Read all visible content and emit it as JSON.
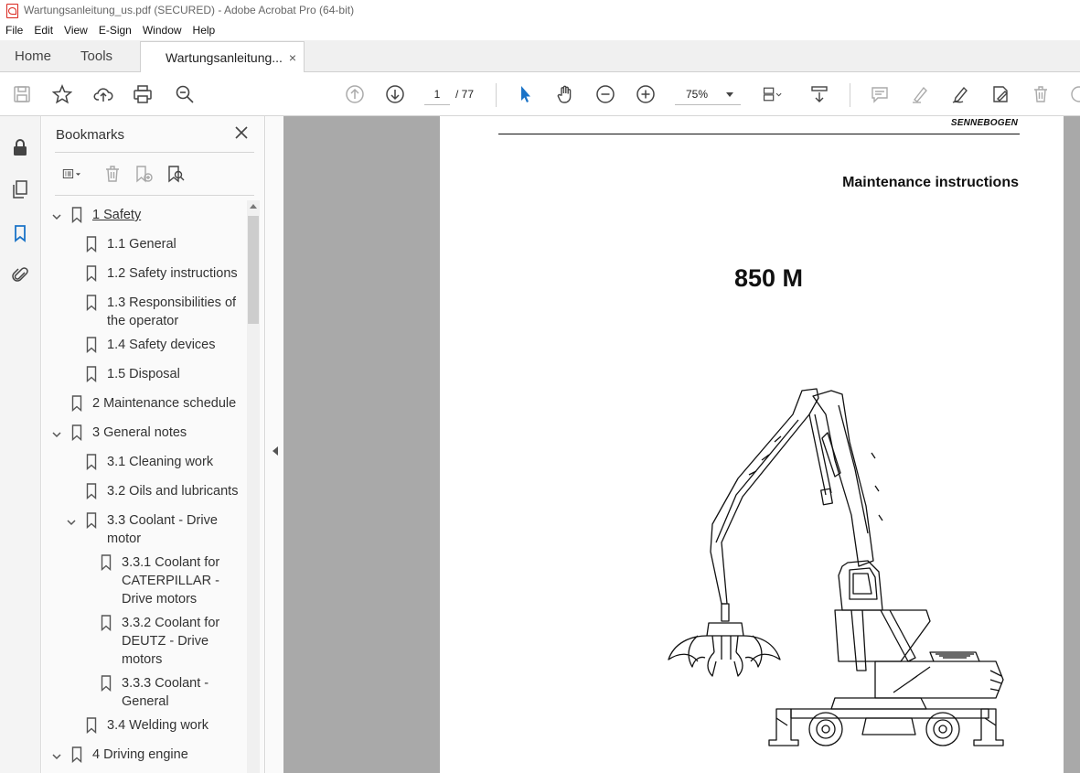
{
  "window": {
    "title": "Wartungsanleitung_us.pdf (SECURED) - Adobe Acrobat Pro (64-bit)"
  },
  "menu": [
    "File",
    "Edit",
    "View",
    "E-Sign",
    "Window",
    "Help"
  ],
  "tabs": {
    "home": "Home",
    "tools": "Tools",
    "document": "Wartungsanleitung...",
    "close": "×"
  },
  "toolbar": {
    "page_current": "1",
    "page_total": "/ 77",
    "zoom": "75%"
  },
  "bookmarks": {
    "header": "Bookmarks",
    "items": [
      {
        "label": "1 Safety",
        "expanded": true,
        "selected": true
      },
      {
        "label": "1.1 General"
      },
      {
        "label": "1.2 Safety instructions"
      },
      {
        "label": "1.3 Responsibilities of the operator"
      },
      {
        "label": "1.4 Safety devices"
      },
      {
        "label": "1.5 Disposal"
      },
      {
        "label": "2 Maintenance schedule"
      },
      {
        "label": "3 General notes",
        "expanded": true
      },
      {
        "label": "3.1 Cleaning work"
      },
      {
        "label": "3.2 Oils and lubricants"
      },
      {
        "label": "3.3 Coolant - Drive motor",
        "expanded": true
      },
      {
        "label": "3.3.1 Coolant for CATERPILLAR - Drive motors"
      },
      {
        "label": "3.3.2 Coolant for DEUTZ - Drive motors"
      },
      {
        "label": "3.3.3 Coolant - General"
      },
      {
        "label": "3.4 Welding work"
      },
      {
        "label": "4 Driving engine",
        "expanded": true
      }
    ]
  },
  "document": {
    "logo": "SENNEBOGEN",
    "title": "Maintenance instructions",
    "model": "850 M"
  },
  "colors": {
    "accent": "#1a73c7",
    "pdf_red": "#d9251c",
    "doc_bg": "#a9a9a9"
  }
}
